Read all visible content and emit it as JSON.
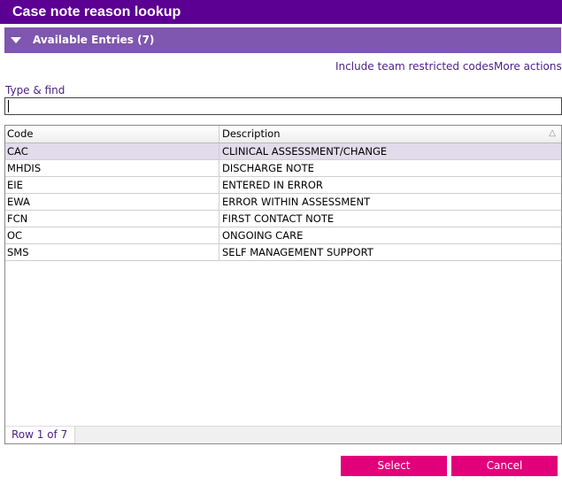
{
  "window": {
    "title": "Case note reason lookup"
  },
  "section": {
    "title": "Available Entries (7)"
  },
  "links": {
    "include_restricted": "Include team restricted codes",
    "more_actions": "More actions"
  },
  "search": {
    "label": "Type & find",
    "value": ""
  },
  "table": {
    "columns": [
      "Code",
      "Description"
    ],
    "rows": [
      {
        "code": "CAC",
        "description": "CLINICAL ASSESSMENT/CHANGE",
        "selected": true
      },
      {
        "code": "MHDIS",
        "description": "DISCHARGE NOTE"
      },
      {
        "code": "EIE",
        "description": "ENTERED IN ERROR"
      },
      {
        "code": "EWA",
        "description": "ERROR WITHIN ASSESSMENT"
      },
      {
        "code": "FCN",
        "description": "FIRST CONTACT NOTE"
      },
      {
        "code": "OC",
        "description": "ONGOING CARE"
      },
      {
        "code": "SMS",
        "description": "SELF MANAGEMENT SUPPORT"
      }
    ],
    "row_status": "Row 1 of 7",
    "sort_icon": "sort-ascending-icon"
  },
  "buttons": {
    "select": "Select",
    "cancel": "Cancel"
  },
  "colors": {
    "title_bar": "#5c0094",
    "section_header": "#7f56b0",
    "link": "#4b1e86",
    "button": "#e2007a",
    "selected_row": "#e2dbeb"
  }
}
